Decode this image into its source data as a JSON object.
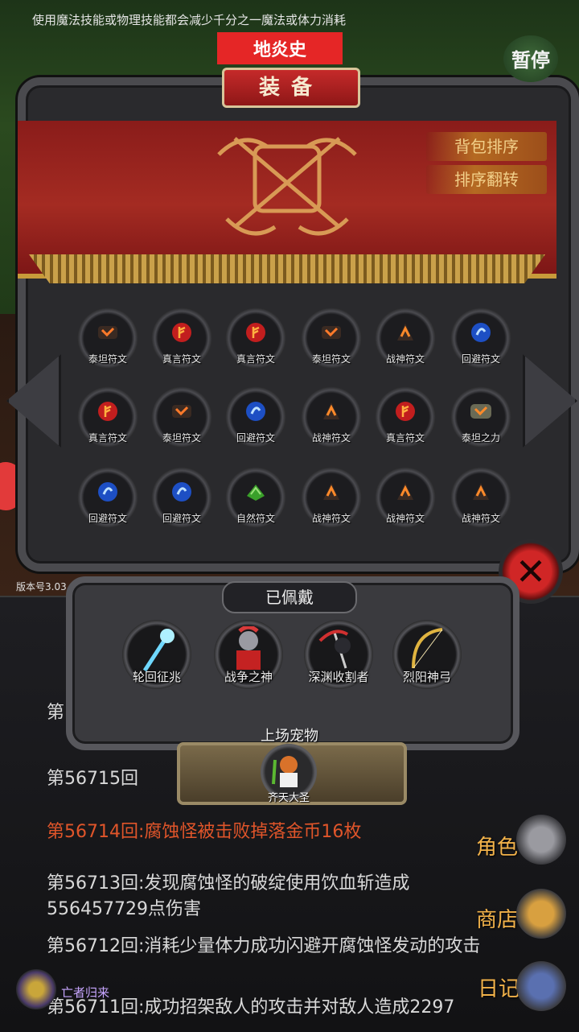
{
  "tip": "使用魔法技能或物理技能都会减少千分之一魔法或体力消耗",
  "red_tag": "地炎史",
  "pause_label": "暂停",
  "title": "装备",
  "banner_buttons": [
    "背包排序",
    "排序翻转"
  ],
  "grid": [
    [
      {
        "label": "泰坦符文",
        "kind": "titan"
      },
      {
        "label": "真言符文",
        "kind": "truth"
      },
      {
        "label": "真言符文",
        "kind": "truth"
      },
      {
        "label": "泰坦符文",
        "kind": "titan"
      },
      {
        "label": "战神符文",
        "kind": "war"
      },
      {
        "label": "回避符文",
        "kind": "evade"
      }
    ],
    [
      {
        "label": "真言符文",
        "kind": "truth"
      },
      {
        "label": "泰坦符文",
        "kind": "titan"
      },
      {
        "label": "回避符文",
        "kind": "evade"
      },
      {
        "label": "战神符文",
        "kind": "war"
      },
      {
        "label": "真言符文",
        "kind": "truth"
      },
      {
        "label": "泰坦之力",
        "kind": "titan-power"
      }
    ],
    [
      {
        "label": "回避符文",
        "kind": "evade"
      },
      {
        "label": "回避符文",
        "kind": "evade"
      },
      {
        "label": "自然符文",
        "kind": "nature"
      },
      {
        "label": "战神符文",
        "kind": "war"
      },
      {
        "label": "战神符文",
        "kind": "war"
      },
      {
        "label": "战神符文",
        "kind": "war"
      }
    ]
  ],
  "version_label": "版本号3.03",
  "equipped": {
    "title": "已佩戴",
    "items": [
      {
        "label": "轮回征兆",
        "icon": "ice-staff-icon"
      },
      {
        "label": "战争之神",
        "icon": "war-god-icon"
      },
      {
        "label": "深渊收割者",
        "icon": "reaper-icon"
      },
      {
        "label": "烈阳神弓",
        "icon": "bow-icon"
      }
    ]
  },
  "pet": {
    "title": "上场宠物",
    "name": "齐天大圣"
  },
  "log": {
    "partial_top": "第",
    "line1": "第56715回",
    "line2": "第56714回:腐蚀怪被击败掉落金币16枚",
    "line3": "第56713回:发现腐蚀怪的破绽使用饮血斩造成556457729点伤害",
    "line4": "第56712回:消耗少量体力成功闪避开腐蚀怪发动的攻击",
    "line5": "第56711回:成功招架敌人的攻击并对敌人造成2297"
  },
  "right_menu": [
    "角色",
    "商店",
    "日记"
  ],
  "player_name": "亡者归来",
  "colors": {
    "accent_red": "#e52626",
    "gold": "#f2b24a",
    "banner": "#a42b22"
  }
}
